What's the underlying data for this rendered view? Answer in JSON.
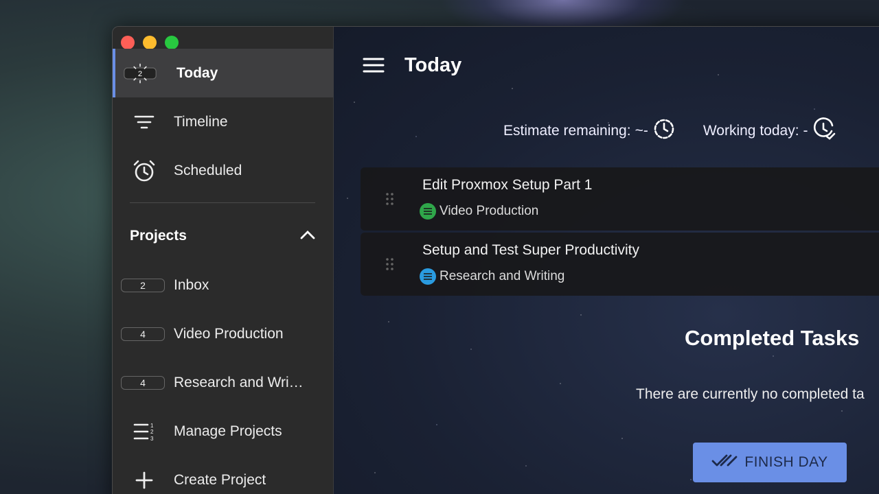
{
  "sidebar": {
    "today": {
      "label": "Today",
      "badge": "2"
    },
    "timeline": {
      "label": "Timeline"
    },
    "scheduled": {
      "label": "Scheduled"
    },
    "projects_header": "Projects",
    "projects": [
      {
        "label": "Inbox",
        "count": "2"
      },
      {
        "label": "Video Production",
        "count": "4"
      },
      {
        "label": "Research and Wri…",
        "count": "4"
      }
    ],
    "manage_projects": "Manage Projects",
    "create_project": "Create Project"
  },
  "header": {
    "title": "Today",
    "estimate_label": "Estimate remaining:",
    "estimate_value": "~-",
    "working_label": "Working today:",
    "working_value": "-"
  },
  "tasks": [
    {
      "title": "Edit Proxmox Setup Part 1",
      "project": "Video Production",
      "project_color": "#2fa64a"
    },
    {
      "title": "Setup and Test Super Productivity",
      "project": "Research and Writing",
      "project_color": "#2a9be0"
    }
  ],
  "completed": {
    "title": "Completed Tasks",
    "empty_text": "There are currently no completed ta",
    "finish_button": "FINISH DAY"
  },
  "colors": {
    "accent": "#6a8fe6",
    "sidebar_bg": "#2b2b2b"
  }
}
